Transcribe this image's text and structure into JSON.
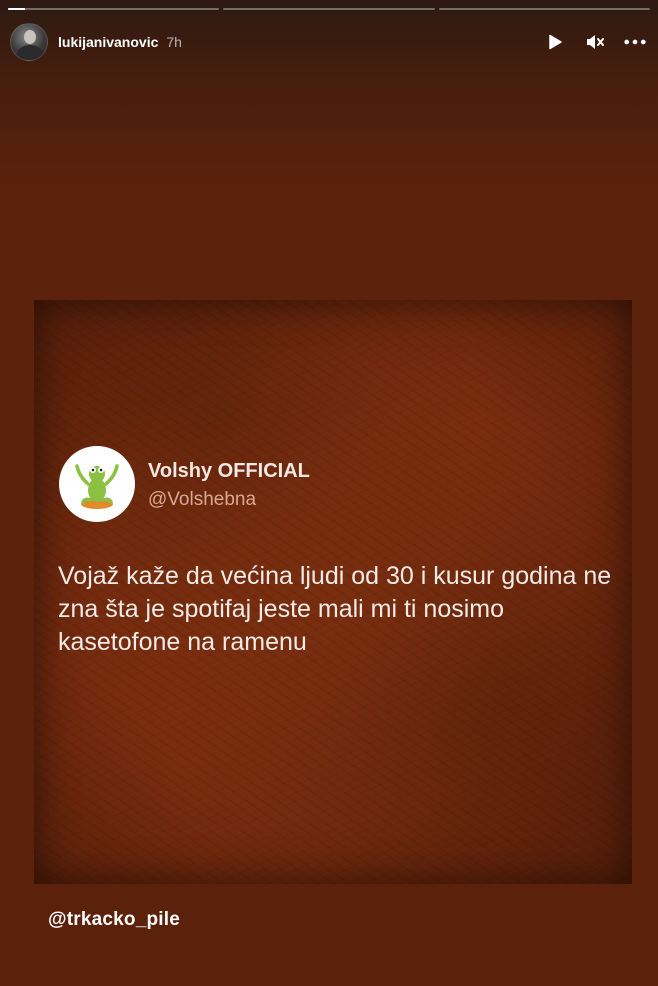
{
  "story": {
    "progress": [
      0.08,
      0,
      0
    ],
    "username": "lukijanivanovic",
    "time": "7h"
  },
  "controls": {
    "play_icon": "play-icon",
    "mute_icon": "mute-icon",
    "more_icon": "more-options-icon"
  },
  "post": {
    "name": "Volshy OFFICIAL",
    "handle": "@Volshebna",
    "text": "Vojaž kaže da većina ljudi od 30 i kusur godina ne zna šta je spotifaj jeste mali mi ti nosimo kasetofone na ramenu"
  },
  "mention": "@trkacko_pile"
}
